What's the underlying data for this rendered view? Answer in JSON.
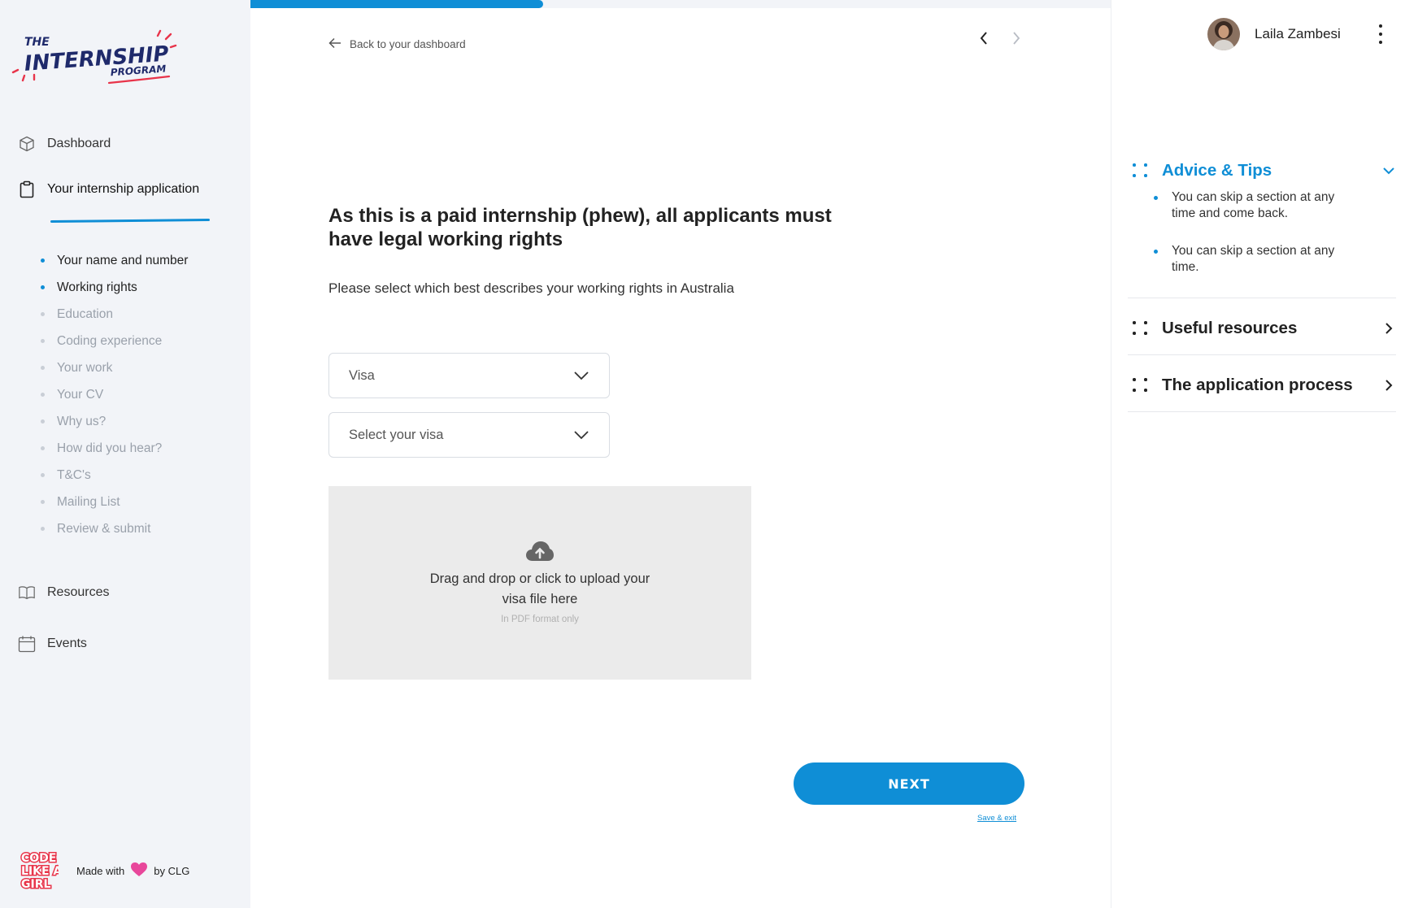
{
  "brand": {
    "logo_line1": "THE",
    "logo_line2": "INTERNSHIP",
    "logo_line3": "PROGRAM"
  },
  "sidebar": {
    "nav": [
      {
        "label": "Dashboard",
        "icon": "cube-icon"
      },
      {
        "label": "Your internship application",
        "icon": "clipboard-icon"
      },
      {
        "label": "Resources",
        "icon": "book-icon"
      },
      {
        "label": "Events",
        "icon": "calendar-icon"
      }
    ],
    "steps": [
      {
        "label": "Your name and number",
        "done": true
      },
      {
        "label": "Working rights",
        "done": true
      },
      {
        "label": "Education",
        "done": false
      },
      {
        "label": "Coding experience",
        "done": false
      },
      {
        "label": "Your work",
        "done": false
      },
      {
        "label": "Your CV",
        "done": false
      },
      {
        "label": "Why us?",
        "done": false
      },
      {
        "label": "How did you hear?",
        "done": false
      },
      {
        "label": "T&C's",
        "done": false
      },
      {
        "label": "Mailing List",
        "done": false
      },
      {
        "label": "Review & submit",
        "done": false
      }
    ],
    "footer": {
      "clg_logo_text": "CODE LIKE A GIRL",
      "made_with": "Made with",
      "by": "by CLG"
    }
  },
  "main": {
    "progress": 0.34,
    "back_label": "Back to your dashboard",
    "heading": "As this is a paid internship (phew), all applicants must have legal working rights",
    "subheading": "Please select which best describes your working rights in Australia",
    "select_type": {
      "value": "Visa"
    },
    "select_visa": {
      "placeholder": "Select your visa"
    },
    "upload": {
      "text": "Drag and drop or click to upload your visa file here",
      "hint": "In PDF format only"
    },
    "next_label": "NEXT",
    "save_exit_label": "Save & exit"
  },
  "right_panel": {
    "user_name": "Laila Zambesi",
    "accordion": [
      {
        "title": "Advice & Tips",
        "open": true,
        "tips": [
          "You can skip a section at any time and come back.",
          "You can skip a section at any time."
        ]
      },
      {
        "title": "Useful resources",
        "open": false
      },
      {
        "title": "The application process",
        "open": false
      }
    ]
  },
  "colors": {
    "accent": "#0f8ed6",
    "sidebar_bg": "#f2f4f8",
    "upload_bg": "#ebebeb",
    "heart": "#e8479b"
  }
}
